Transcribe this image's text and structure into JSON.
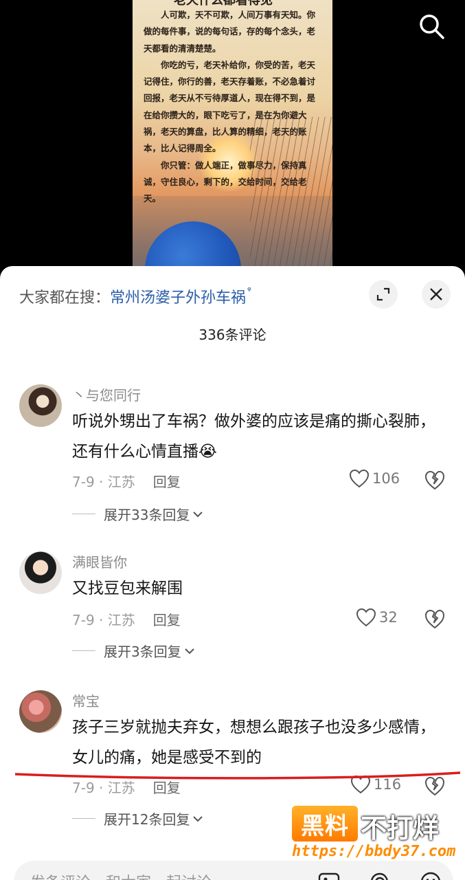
{
  "poster": {
    "title": "老天什么都看得见",
    "paragraphs": [
      "人可欺，天不可欺，人间万事有天知。你做的每件事，说的每句话，存的每个念头，老天都看的清清楚楚。",
      "你吃的亏，老天补给你，你受的苦，老天记得住，你行的善，老天存着账，不必急着讨回报，老天从不亏待厚道人，现在得不到，是在给你攒大的，眼下吃亏了，是在为你避大祸，老天的算盘，比人算的精细，老天的账本，比人记得周全。",
      "你只管：做人端正，做事尽力，保持真诚，守住良心，剩下的，交给时间，交给老天。"
    ]
  },
  "header": {
    "search_prefix": "大家都在搜：",
    "search_term": "常州汤婆子外孙车祸",
    "comment_count": "336条评论"
  },
  "comments": [
    {
      "user": "丶与您同行",
      "text": "听说外甥出了车祸？做外婆的应该是痛的撕心裂肺，还有什么心情直播😭",
      "date_location": "7-9 · 江苏",
      "reply_label": "回复",
      "likes": "106",
      "expand_label": "展开33条回复"
    },
    {
      "user": "满眼皆你",
      "text": "又找豆包来解围",
      "date_location": "7-9 · 江苏",
      "reply_label": "回复",
      "likes": "32",
      "expand_label": "展开3条回复"
    },
    {
      "user": "常宝",
      "text": "孩子三岁就抛夫弃女，想想么跟孩子也没多少感情，女儿的痛，她是感受不到的",
      "date_location": "7-9 · 江苏",
      "reply_label": "回复",
      "likes": "116",
      "expand_label": "展开12条回复"
    }
  ],
  "input": {
    "placeholder": "发条评论，和大家一起讨论"
  },
  "watermark": {
    "box_text": "黑料",
    "side_text": "不打烊",
    "url": "https://bbdy37.com"
  },
  "icons": [
    "search-icon",
    "expand-icon",
    "close-icon",
    "heart-icon",
    "broken-heart-icon",
    "chevron-down-icon",
    "image-icon",
    "at-icon",
    "emoji-icon"
  ],
  "colors": {
    "link": "#2a5da8",
    "underline": "#d81e1e",
    "watermark": "#ff8c00"
  }
}
